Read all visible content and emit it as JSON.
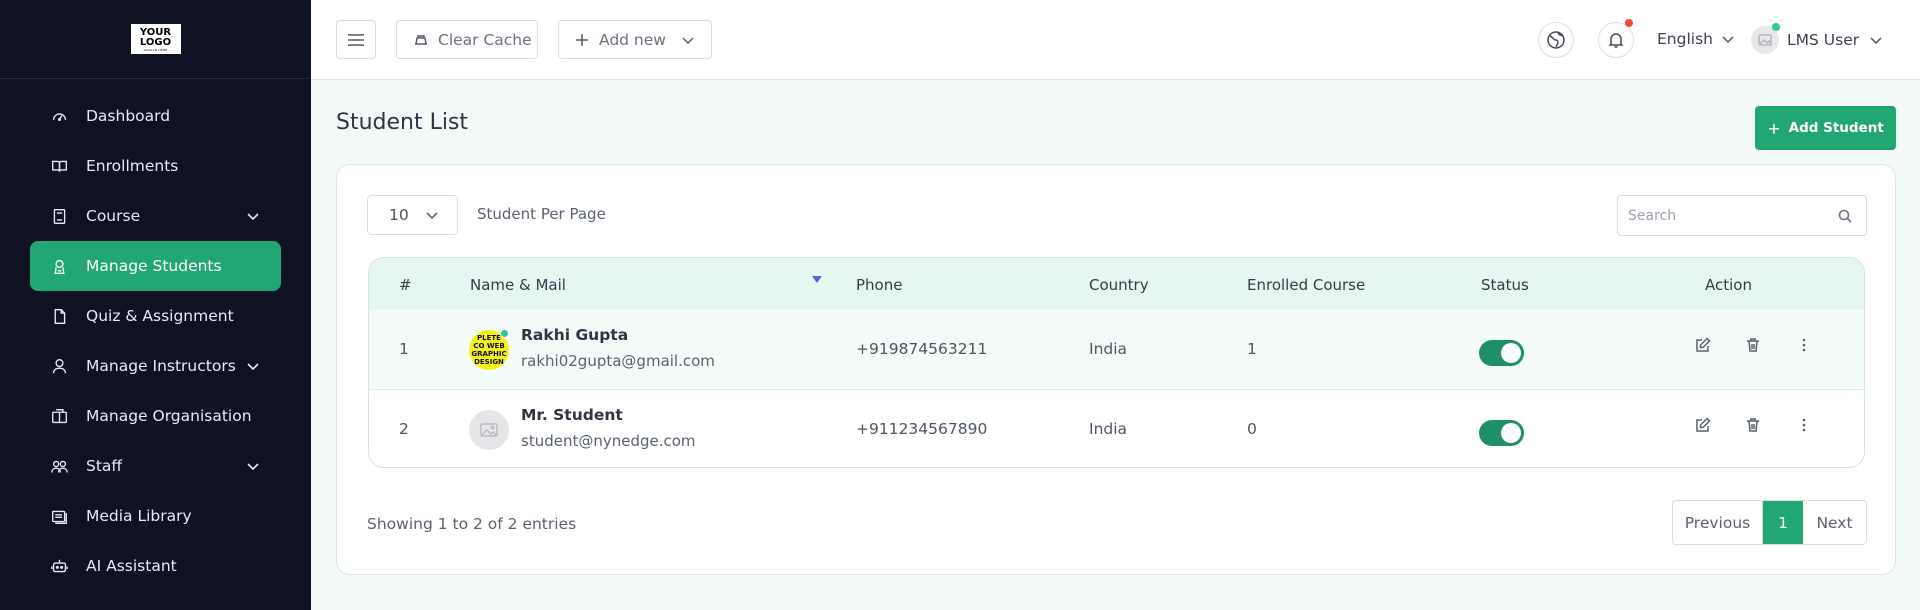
{
  "logo": {
    "line1": "YOUR",
    "line2": "LOGO",
    "tagline": "SLOGAN HERE"
  },
  "sidebar": {
    "items": [
      {
        "label": "Dashboard",
        "icon": "gauge-icon"
      },
      {
        "label": "Enrollments",
        "icon": "book-open-icon"
      },
      {
        "label": "Course",
        "icon": "book-icon",
        "has_submenu": true
      },
      {
        "label": "Manage Students",
        "icon": "graduate-icon",
        "active": true
      },
      {
        "label": "Quiz & Assignment",
        "icon": "file-icon"
      },
      {
        "label": "Manage Instructors",
        "icon": "user-icon",
        "has_submenu": true
      },
      {
        "label": "Manage Organisation",
        "icon": "building-icon"
      },
      {
        "label": "Staff",
        "icon": "users-icon",
        "has_submenu": true
      },
      {
        "label": "Media Library",
        "icon": "media-icon"
      },
      {
        "label": "AI Assistant",
        "icon": "robot-icon"
      }
    ]
  },
  "topbar": {
    "clear_cache": "Clear Cache",
    "add_new": "Add new",
    "language": "English",
    "user_name": "LMS User"
  },
  "page": {
    "title": "Student List",
    "add_button": "Add Student"
  },
  "controls": {
    "per_page_value": "10",
    "per_page_label": "Student Per Page",
    "search_placeholder": "Search"
  },
  "table": {
    "headers": [
      "#",
      "Name & Mail",
      "Phone",
      "Country",
      "Enrolled Course",
      "Status",
      "Action"
    ],
    "rows": [
      {
        "index": "1",
        "name": "Rakhi Gupta",
        "email": "rakhi02gupta@gmail.com",
        "phone": "+919874563211",
        "country": "India",
        "enrolled": "1",
        "status_on": true,
        "avatar_text": "PLETE CO WEB GRAPHIC DESIGN"
      },
      {
        "index": "2",
        "name": "Mr. Student",
        "email": "student@nynedge.com",
        "phone": "+911234567890",
        "country": "India",
        "enrolled": "0",
        "status_on": true
      }
    ]
  },
  "footer": {
    "showing": "Showing 1 to 2 of 2 entries",
    "prev": "Previous",
    "page": "1",
    "next": "Next"
  },
  "colors": {
    "accent": "#22a674",
    "sidebar_bg": "#0f1223",
    "notification": "#ef4c3d",
    "online": "#2ec996"
  }
}
